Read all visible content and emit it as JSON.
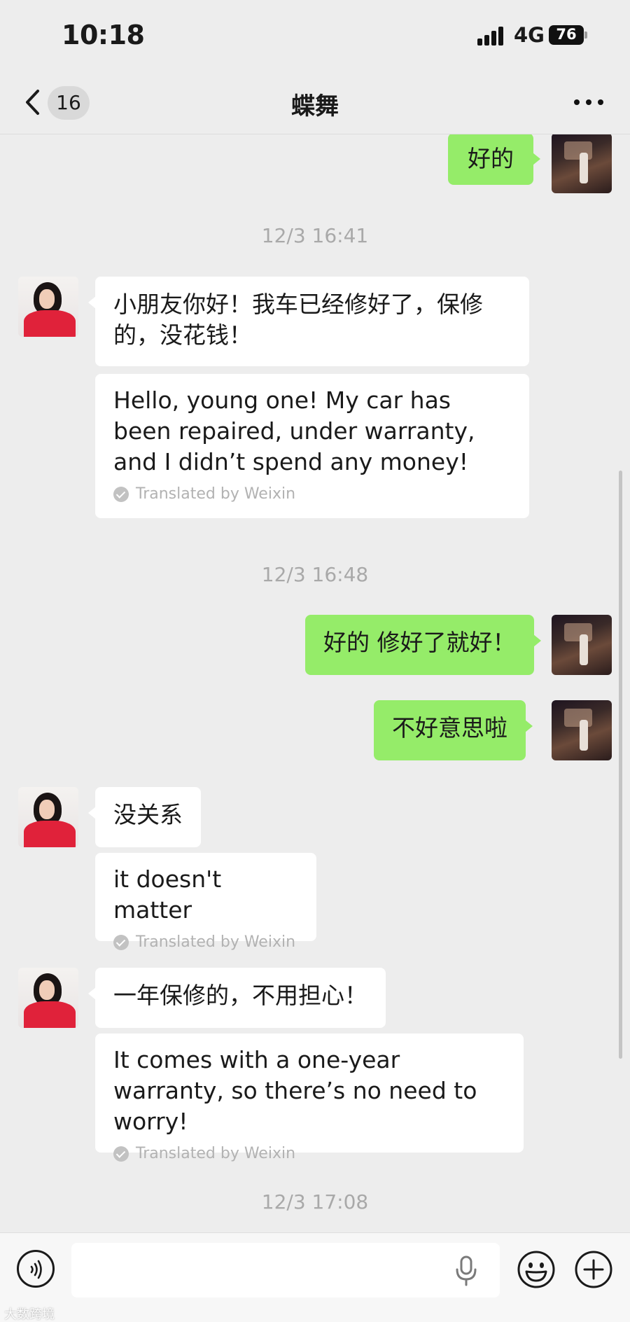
{
  "status_bar": {
    "time": "10:18",
    "network": "4G",
    "battery": "76"
  },
  "nav": {
    "unread_count": "16",
    "title": "蝶舞"
  },
  "messages": [
    {
      "side": "out",
      "text": "好的"
    },
    {
      "timestamp": "12/3 16:41"
    },
    {
      "side": "in",
      "text": "小朋友你好！我车已经修好了，保修的，没花钱！",
      "translation": "Hello, young one! My car has been repaired, under warranty, and I didn’t spend any money!",
      "translated_by": "Translated by Weixin"
    },
    {
      "timestamp": "12/3 16:48"
    },
    {
      "side": "out",
      "text": "好的 修好了就好！"
    },
    {
      "side": "out",
      "text": "不好意思啦"
    },
    {
      "side": "in",
      "text": "没关系",
      "translation": "it doesn't matter",
      "translated_by": "Translated by Weixin"
    },
    {
      "side": "in",
      "text": "一年保修的，不用担心！",
      "translation": "It comes with a one-year warranty, so there’s no need to worry!",
      "translated_by": "Translated by Weixin"
    },
    {
      "timestamp": "12/3 17:08"
    }
  ],
  "input": {
    "placeholder": ""
  },
  "watermark": "大数跨境",
  "icons": [
    "back-chevron-icon",
    "more-icon",
    "voice-icon",
    "microphone-icon",
    "emoji-icon",
    "plus-icon"
  ]
}
